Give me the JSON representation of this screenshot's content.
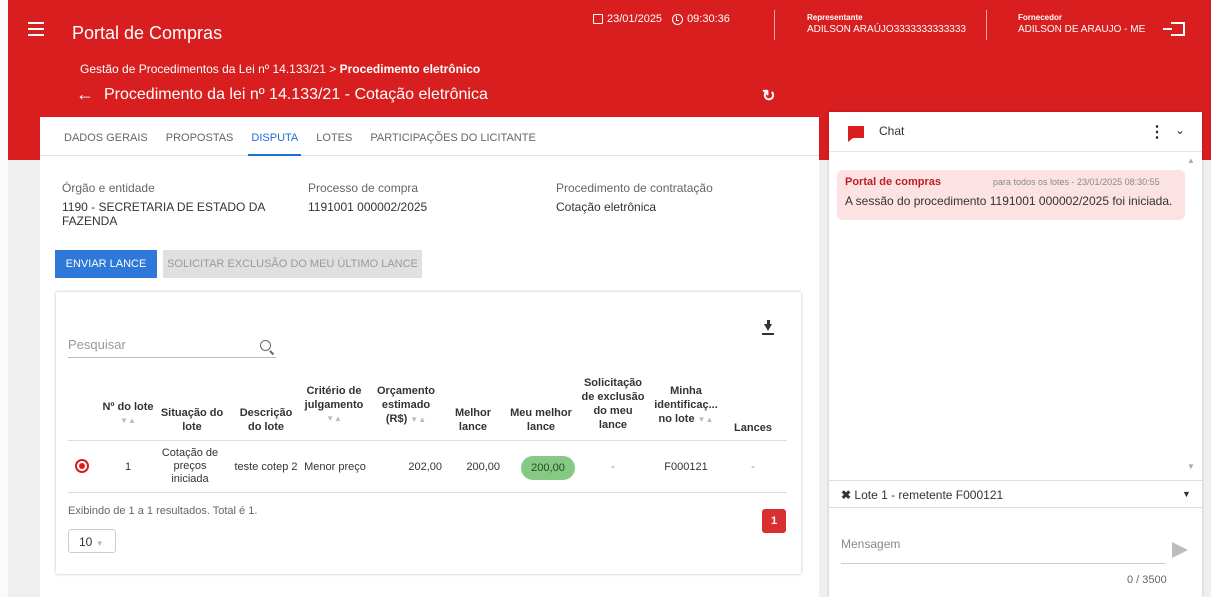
{
  "header": {
    "app_title": "Portal de Compras",
    "date": "23/01/2025",
    "time": "09:30:36",
    "representative_label": "Representante",
    "representative_name": "ADILSON ARAÚJO3333333333333",
    "supplier_label": "Fornecedor",
    "supplier_name": "ADILSON DE ARAUJO - ME",
    "breadcrumb_parent": "Gestão de Procedimentos da Lei nº 14.133/21 > ",
    "breadcrumb_current": "Procedimento eletrônico",
    "page_title": "Procedimento da lei nº 14.133/21 - Cotação eletrônica",
    "accent_color": "#d81e1e"
  },
  "tabs": [
    {
      "label": "DADOS GERAIS"
    },
    {
      "label": "PROPOSTAS"
    },
    {
      "label": "DISPUTA",
      "active": true
    },
    {
      "label": "LOTES"
    },
    {
      "label": "PARTICIPAÇÕES DO LICITANTE"
    }
  ],
  "info": {
    "org_label": "Órgão e entidade",
    "org_value": "1190 - SECRETARIA DE ESTADO DA FAZENDA",
    "process_label": "Processo de compra",
    "process_value": "1191001 000002/2025",
    "procedure_label": "Procedimento de contratação",
    "procedure_value": "Cotação eletrônica"
  },
  "actions": {
    "send_bid": "ENVIAR LANCE",
    "request_exclusion": "SOLICITAR EXCLUSÃO DO MEU ÚLTIMO LANCE"
  },
  "table": {
    "search_placeholder": "Pesquisar",
    "columns": [
      "Nº do lote",
      "Situação do lote",
      "Descrição do lote",
      "Critério de julgamento",
      "Orçamento estimado (R$)",
      "Melhor lance",
      "Meu melhor lance",
      "Solicitação de exclusão do meu lance",
      "Minha identificaç... no lote",
      "Lances"
    ],
    "rows": [
      {
        "lot": "1",
        "status": "Cotação de preços iniciada",
        "description": "teste cotep 2",
        "criterion": "Menor preço",
        "estimate": "202,00",
        "best_bid": "200,00",
        "my_best_bid": "200,00",
        "exclusion_request": "-",
        "my_id": "F000121",
        "bids": "-"
      }
    ],
    "footer_text": "Exibindo de 1 a 1 resultados. Total é 1.",
    "page_size": "10",
    "current_page": "1"
  },
  "chat": {
    "title": "Chat",
    "message_sender": "Portal de compras",
    "message_meta": "para todos os lotes  -  23/01/2025 08:30:55",
    "message_text": "A sessão do procedimento 1191001 000002/2025 foi iniciada.",
    "lot_selector": "Lote 1 - remetente F000121",
    "input_placeholder": "Mensagem",
    "char_count": "0 / 3500"
  }
}
